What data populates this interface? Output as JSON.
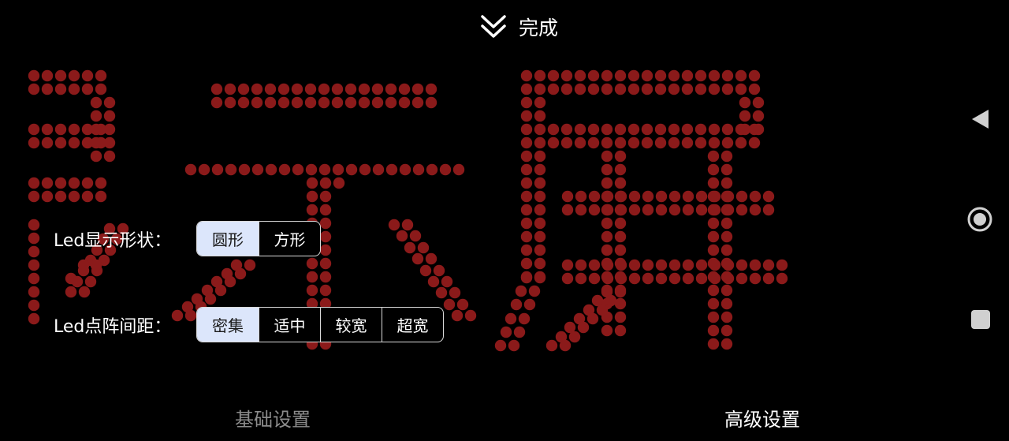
{
  "header": {
    "done_label": "完成",
    "collapse_icon": "double-chevron-down-icon"
  },
  "led": {
    "dot_color": "#8b1a1a",
    "dot_shape": "circle"
  },
  "settings": {
    "shape": {
      "label": "Led显示形状：",
      "options": [
        "圆形",
        "方形"
      ],
      "selected": "圆形"
    },
    "spacing": {
      "label": "Led点阵间距：",
      "options": [
        "密集",
        "适中",
        "较宽",
        "超宽"
      ],
      "selected": "密集"
    }
  },
  "tabs": {
    "basic": "基础设置",
    "advanced": "高级设置",
    "active": "高级设置"
  },
  "navbar": {
    "back_icon": "back-triangle-icon",
    "home_icon": "home-circle-icon",
    "recents_icon": "recents-square-icon"
  },
  "colors": {
    "selected_bg": "#dce6fb",
    "tab_inactive": "#8c8c8c",
    "background": "#000000"
  }
}
